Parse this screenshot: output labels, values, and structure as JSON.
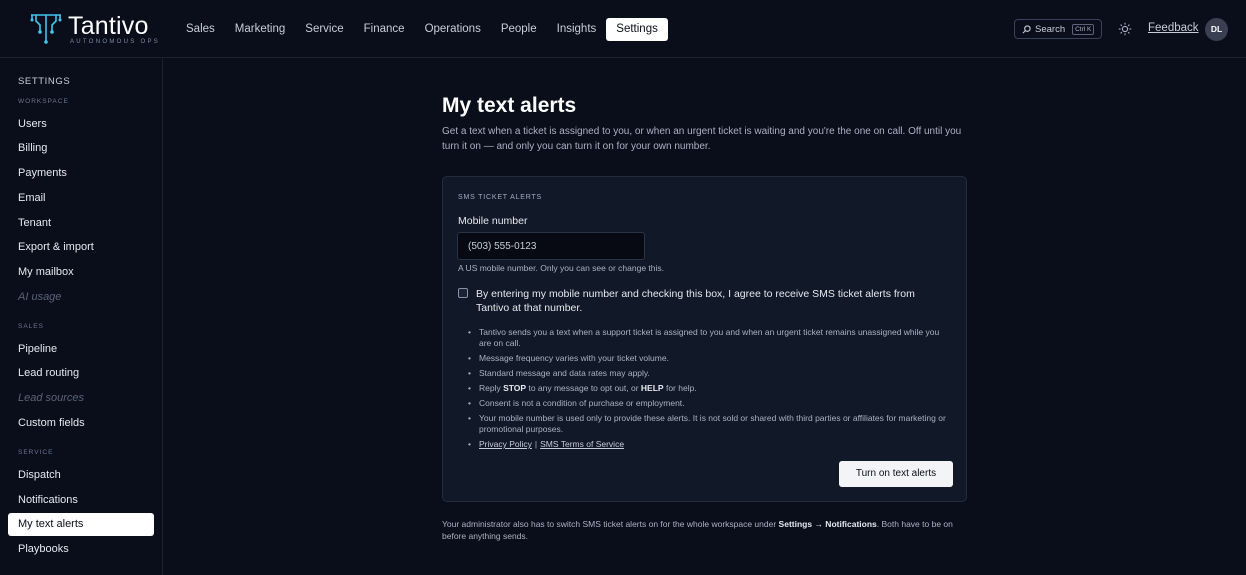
{
  "brand": {
    "name": "Tantivo",
    "tagline": "AUTONOMOUS OPS"
  },
  "nav": {
    "items": [
      "Sales",
      "Marketing",
      "Service",
      "Finance",
      "Operations",
      "People",
      "Insights",
      "Settings"
    ],
    "active": "Settings"
  },
  "header": {
    "search_label": "Search",
    "search_shortcut": "Ctrl K",
    "feedback_label": "Feedback",
    "avatar_initials": "DL"
  },
  "sidebar": {
    "title": "SETTINGS",
    "groups": [
      {
        "label": "WORKSPACE",
        "items": [
          {
            "label": "Users"
          },
          {
            "label": "Billing"
          },
          {
            "label": "Payments"
          },
          {
            "label": "Email"
          },
          {
            "label": "Tenant"
          },
          {
            "label": "Export & import"
          },
          {
            "label": "My mailbox"
          },
          {
            "label": "AI usage",
            "muted": true
          }
        ]
      },
      {
        "label": "SALES",
        "items": [
          {
            "label": "Pipeline"
          },
          {
            "label": "Lead routing"
          },
          {
            "label": "Lead sources",
            "muted": true
          },
          {
            "label": "Custom fields"
          }
        ]
      },
      {
        "label": "SERVICE",
        "items": [
          {
            "label": "Dispatch"
          },
          {
            "label": "Notifications"
          },
          {
            "label": "My text alerts",
            "active": true
          },
          {
            "label": "Playbooks"
          }
        ]
      }
    ]
  },
  "page": {
    "title": "My text alerts",
    "description": "Get a text when a ticket is assigned to you, or when an urgent ticket is waiting and you're the one on call. Off until you turn it on — and only you can turn it on for your own number."
  },
  "card": {
    "label": "SMS TICKET ALERTS",
    "field_label": "Mobile number",
    "input_value": "(503) 555-0123",
    "hint": "A US mobile number. Only you can see or change this.",
    "consent_checked": false,
    "consent_text": "By entering my mobile number and checking this box, I agree to receive SMS ticket alerts from Tantivo at that number.",
    "bullets": {
      "b1": "Tantivo sends you a text when a support ticket is assigned to you and when an urgent ticket remains unassigned while you are on call.",
      "b2": "Message frequency varies with your ticket volume.",
      "b3": "Standard message and data rates may apply.",
      "b4_pre": "Reply ",
      "b4_stop": "STOP",
      "b4_mid": " to any message to opt out, or ",
      "b4_help": "HELP",
      "b4_post": " for help.",
      "b5": "Consent is not a condition of purchase or employment.",
      "b6": "Your mobile number is used only to provide these alerts. It is not sold or shared with third parties or affiliates for marketing or promotional purposes."
    },
    "privacy_link": "Privacy Policy",
    "link_separator": "|",
    "terms_link": "SMS Terms of Service",
    "button_label": "Turn on text alerts"
  },
  "footer": {
    "pre": "Your administrator also has to switch SMS ticket alerts on for the whole workspace under ",
    "path": "Settings → Notifications",
    "post": ". Both have to be on before anything sends."
  }
}
